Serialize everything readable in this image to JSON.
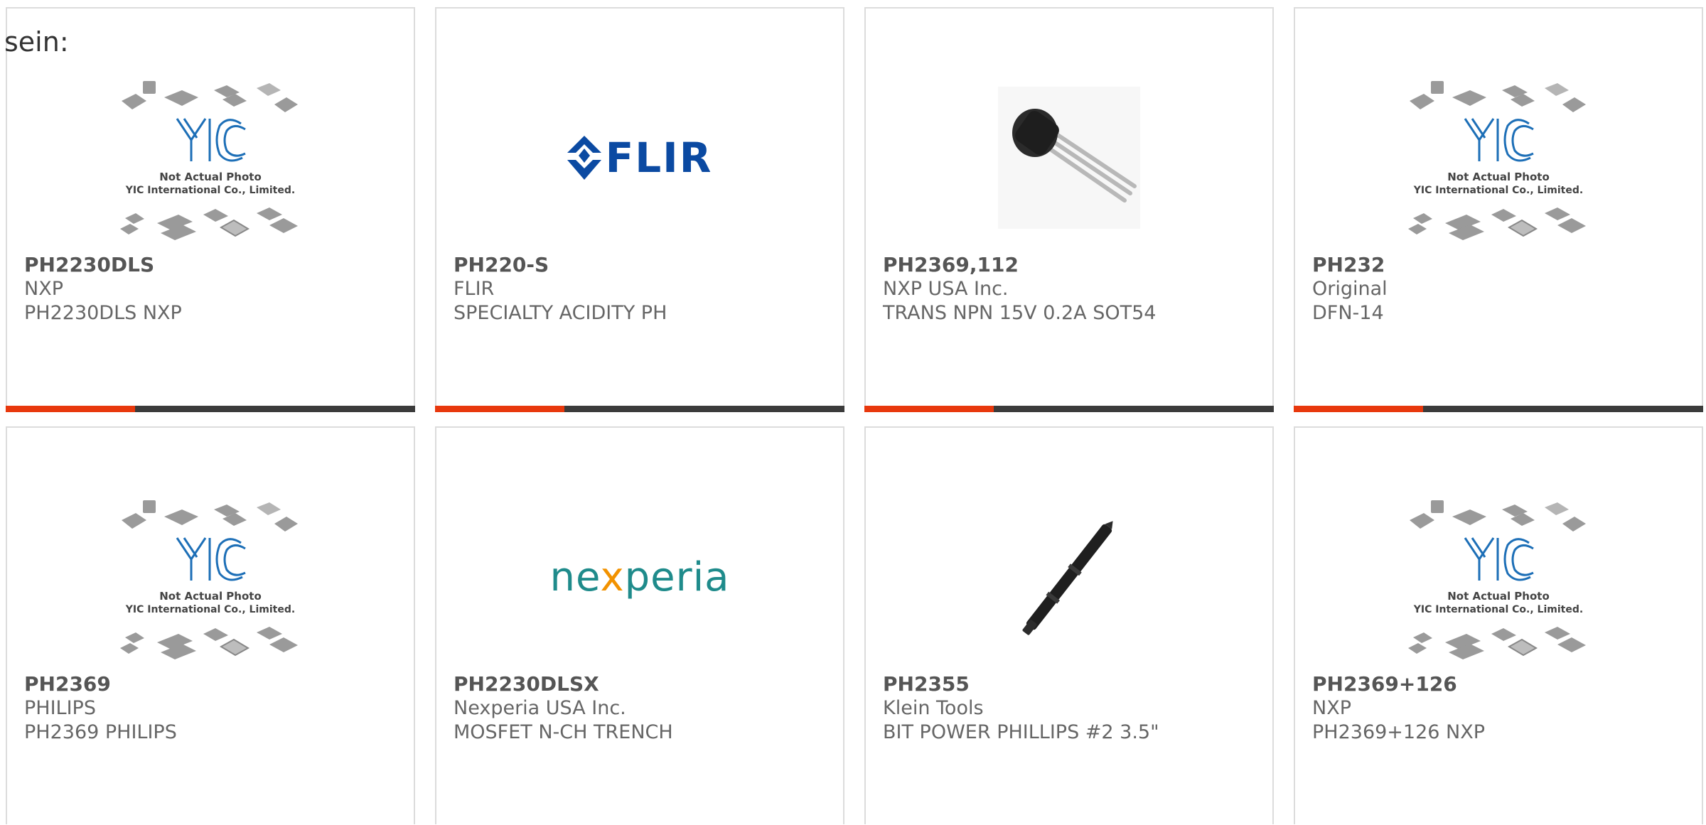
{
  "intro_text": "sein:",
  "colors": {
    "accent_bar": "#e8380d",
    "dark_bar": "#3b3b3b",
    "flir_blue": "#0b4aa2",
    "nexperia_teal": "#1f8b8b",
    "nexperia_orange": "#f29200",
    "yic_blue": "#1d6fb7"
  },
  "placeholder": {
    "line1": "Not Actual Photo",
    "line2": "YIC International Co., Limited."
  },
  "logos": {
    "flir": "FLIR",
    "nexperia_pre": "ne",
    "nexperia_x": "x",
    "nexperia_post": "peria"
  },
  "products": [
    {
      "part": "PH2230DLS",
      "mfr": "NXP",
      "desc": "PH2230DLS NXP",
      "image": "yic-placeholder"
    },
    {
      "part": "PH220-S",
      "mfr": "FLIR",
      "desc": "SPECIALTY ACIDITY PH",
      "image": "flir-logo"
    },
    {
      "part": "PH2369,112",
      "mfr": "NXP USA Inc.",
      "desc": "TRANS NPN 15V 0.2A SOT54",
      "image": "to92-transistor"
    },
    {
      "part": "PH232",
      "mfr": "Original",
      "desc": "DFN-14",
      "image": "yic-placeholder"
    },
    {
      "part": "PH2369",
      "mfr": "PHILIPS",
      "desc": "PH2369 PHILIPS",
      "image": "yic-placeholder"
    },
    {
      "part": "PH2230DLSX",
      "mfr": "Nexperia USA Inc.",
      "desc": "MOSFET N-CH TRENCH",
      "image": "nexperia-logo"
    },
    {
      "part": "PH2355",
      "mfr": "Klein Tools",
      "desc": "BIT POWER PHILLIPS #2 3.5\"",
      "image": "screwdriver-bit"
    },
    {
      "part": "PH2369+126",
      "mfr": "NXP",
      "desc": "PH2369+126 NXP",
      "image": "yic-placeholder"
    }
  ]
}
